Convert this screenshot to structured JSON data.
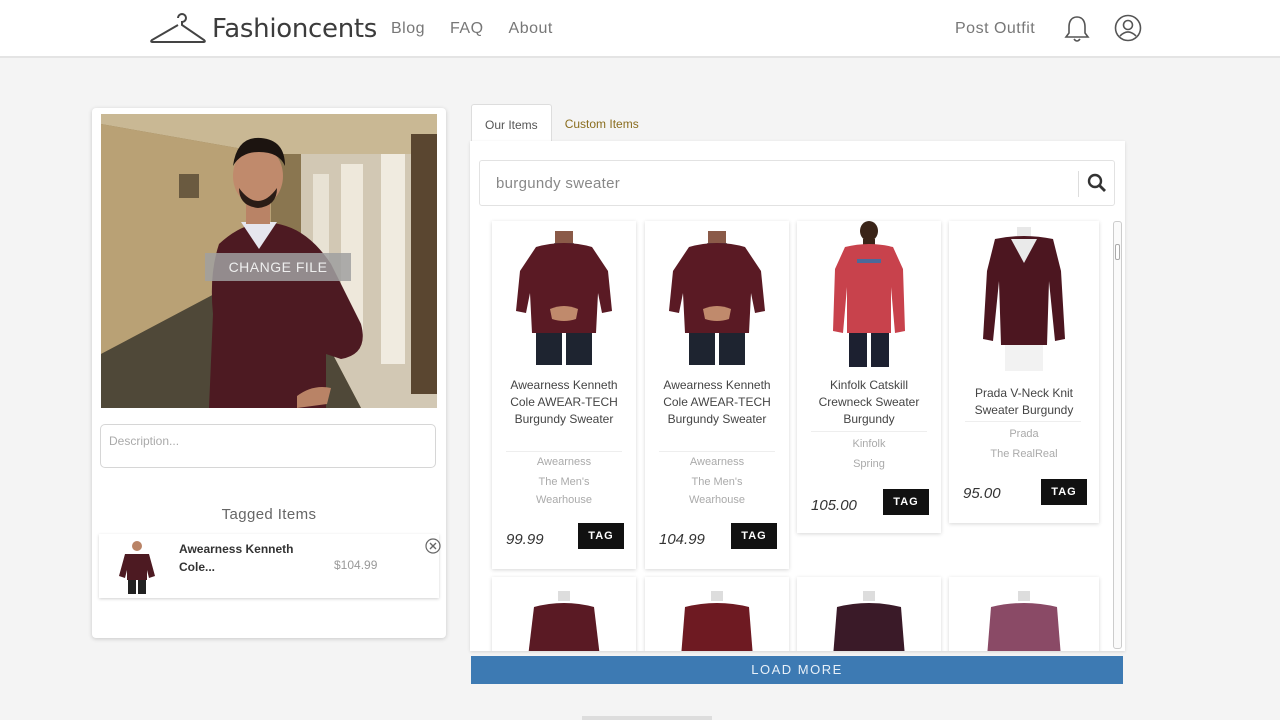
{
  "header": {
    "brand": "Fashioncents",
    "nav": [
      "Blog",
      "FAQ",
      "About"
    ],
    "post_outfit": "Post Outfit"
  },
  "upload": {
    "change_file": "CHANGE FILE",
    "description_placeholder": "Description..."
  },
  "tagged": {
    "title": "Tagged Items",
    "items": [
      {
        "name": "Awearness Kenneth Cole...",
        "price": "$104.99"
      }
    ]
  },
  "tabs": [
    "Our Items",
    "Custom Items"
  ],
  "search": {
    "query": "burgundy sweater"
  },
  "products": [
    {
      "name": "Awearness Kenneth Cole AWEAR-TECH Burgundy Sweater",
      "brand": "Awearness",
      "store": "The Men's Wearhouse",
      "price": "99.99",
      "tag": "TAG",
      "color": "#5a1a24"
    },
    {
      "name": "Awearness Kenneth Cole AWEAR-TECH Burgundy Sweater",
      "brand": "Awearness",
      "store": "The Men's Wearhouse",
      "price": "104.99",
      "tag": "TAG",
      "color": "#5a1a24"
    },
    {
      "name": "Kinfolk Catskill Crewneck Sweater Burgundy",
      "brand": "Kinfolk",
      "store": "Spring",
      "price": "105.00",
      "tag": "TAG",
      "color": "#c8424c"
    },
    {
      "name": "Prada V-Neck Knit Sweater Burgundy",
      "brand": "Prada",
      "store": "The RealReal",
      "price": "95.00",
      "tag": "TAG",
      "color": "#4c1620"
    }
  ],
  "partial_products": [
    {
      "color": "#5a1a24"
    },
    {
      "color": "#6e1a22"
    },
    {
      "color": "#3a1a28"
    },
    {
      "color": "#8a4a66"
    }
  ],
  "load_more": "LOAD MORE"
}
